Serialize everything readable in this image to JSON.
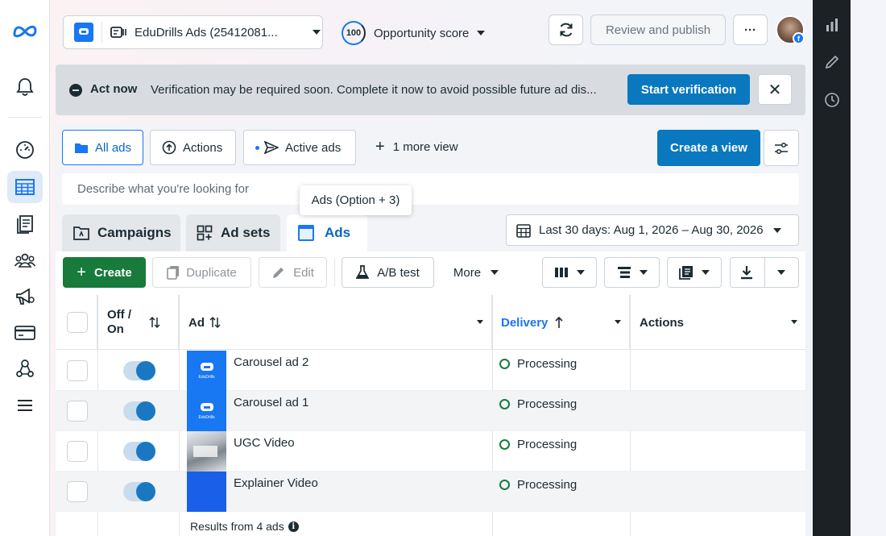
{
  "account": {
    "name": "EduDrills Ads (25412081..."
  },
  "opportunity": {
    "score": "100",
    "label": "Opportunity score"
  },
  "header": {
    "review_label": "Review and publish",
    "more_label": "···"
  },
  "banner": {
    "title": "Act now",
    "message": "Verification may be required soon. Complete it now to avoid possible future ad dis...",
    "button_label": "Start verification",
    "close_label": "✕"
  },
  "views": {
    "tabs": [
      {
        "label": "All ads"
      },
      {
        "label": "Actions"
      },
      {
        "label": "Active ads"
      }
    ],
    "more_label": "1 more view",
    "create_view_label": "Create a view"
  },
  "search": {
    "placeholder": "Describe what you're looking for"
  },
  "tooltip": {
    "text": "Ads (Option + 3)"
  },
  "level_tabs": [
    {
      "label": "Campaigns"
    },
    {
      "label": "Ad sets"
    },
    {
      "label": "Ads"
    }
  ],
  "date_range": {
    "label": "Last 30 days: Aug 1, 2026 – Aug 30, 2026"
  },
  "toolbar": {
    "create_label": "Create",
    "duplicate_label": "Duplicate",
    "edit_label": "Edit",
    "ab_test_label": "A/B test",
    "more_label": "More"
  },
  "table": {
    "columns": {
      "toggle": "Off / On",
      "ad": "Ad",
      "delivery": "Delivery",
      "actions": "Actions"
    },
    "rows": [
      {
        "name": "Carousel ad 2",
        "status": "Processing",
        "thumb_text": "EduDrills"
      },
      {
        "name": "Carousel ad 1",
        "status": "Processing",
        "thumb_text": "EduDrills"
      },
      {
        "name": "UGC Video",
        "status": "Processing"
      },
      {
        "name": "Explainer Video",
        "status": "Processing"
      }
    ],
    "footer": "Results from 4 ads"
  },
  "colors": {
    "accent": "#1877f2",
    "primary_button": "#0a78be",
    "create_green": "#187a3b",
    "toggle_on": "#1a78c2",
    "processing": "#187a3b"
  }
}
